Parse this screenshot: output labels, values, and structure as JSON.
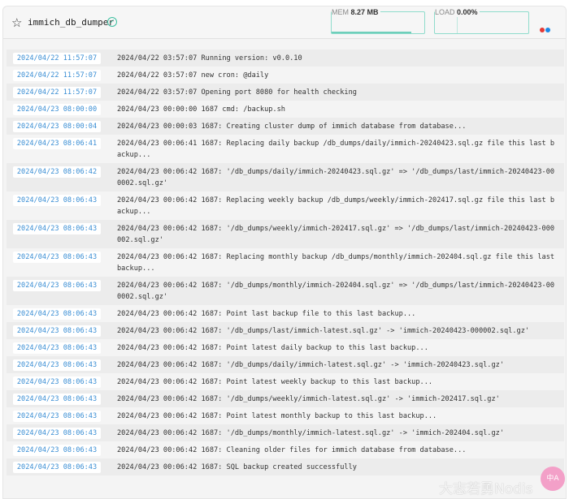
{
  "header": {
    "title": "immich_db_dumper",
    "mem_label": "MEM",
    "mem_value": "8.27 MB",
    "mem_fraction": 0.86,
    "load_label": "LOAD",
    "load_value": "0.00%",
    "status_colors": [
      "#e53935",
      "#1e88e5"
    ]
  },
  "logs": [
    {
      "ts": "2024/04/22 11:57:07",
      "msg": "2024/04/22 03:57:07 Running version: v0.0.10"
    },
    {
      "ts": "2024/04/22 11:57:07",
      "msg": "2024/04/22 03:57:07 new cron: @daily"
    },
    {
      "ts": "2024/04/22 11:57:07",
      "msg": "2024/04/22 03:57:07 Opening port 8080 for health checking"
    },
    {
      "ts": "2024/04/23 08:00:00",
      "msg": "2024/04/23 00:00:00 1687 cmd: /backup.sh"
    },
    {
      "ts": "2024/04/23 08:00:04",
      "msg": "2024/04/23 00:00:03 1687: Creating cluster dump of immich database from database..."
    },
    {
      "ts": "2024/04/23 08:06:41",
      "msg": "2024/04/23 00:06:41 1687: Replacing daily backup /db_dumps/daily/immich-20240423.sql.gz file this last backup..."
    },
    {
      "ts": "2024/04/23 08:06:42",
      "msg": "2024/04/23 00:06:42 1687: '/db_dumps/daily/immich-20240423.sql.gz' => '/db_dumps/last/immich-20240423-000002.sql.gz'"
    },
    {
      "ts": "2024/04/23 08:06:43",
      "msg": "2024/04/23 00:06:42 1687: Replacing weekly backup /db_dumps/weekly/immich-202417.sql.gz file this last backup..."
    },
    {
      "ts": "2024/04/23 08:06:43",
      "msg": "2024/04/23 00:06:42 1687: '/db_dumps/weekly/immich-202417.sql.gz' => '/db_dumps/last/immich-20240423-000002.sql.gz'"
    },
    {
      "ts": "2024/04/23 08:06:43",
      "msg": "2024/04/23 00:06:42 1687: Replacing monthly backup /db_dumps/monthly/immich-202404.sql.gz file this last backup..."
    },
    {
      "ts": "2024/04/23 08:06:43",
      "msg": "2024/04/23 00:06:42 1687: '/db_dumps/monthly/immich-202404.sql.gz' => '/db_dumps/last/immich-20240423-000002.sql.gz'"
    },
    {
      "ts": "2024/04/23 08:06:43",
      "msg": "2024/04/23 00:06:42 1687: Point last backup file to this last backup..."
    },
    {
      "ts": "2024/04/23 08:06:43",
      "msg": "2024/04/23 00:06:42 1687: '/db_dumps/last/immich-latest.sql.gz' -> 'immich-20240423-000002.sql.gz'"
    },
    {
      "ts": "2024/04/23 08:06:43",
      "msg": "2024/04/23 00:06:42 1687: Point latest daily backup to this last backup..."
    },
    {
      "ts": "2024/04/23 08:06:43",
      "msg": "2024/04/23 00:06:42 1687: '/db_dumps/daily/immich-latest.sql.gz' -> 'immich-20240423.sql.gz'"
    },
    {
      "ts": "2024/04/23 08:06:43",
      "msg": "2024/04/23 00:06:42 1687: Point latest weekly backup to this last backup..."
    },
    {
      "ts": "2024/04/23 08:06:43",
      "msg": "2024/04/23 00:06:42 1687: '/db_dumps/weekly/immich-latest.sql.gz' -> 'immich-202417.sql.gz'"
    },
    {
      "ts": "2024/04/23 08:06:43",
      "msg": "2024/04/23 00:06:42 1687: Point latest monthly backup to this last backup..."
    },
    {
      "ts": "2024/04/23 08:06:43",
      "msg": "2024/04/23 00:06:42 1687: '/db_dumps/monthly/immich-latest.sql.gz' -> 'immich-202404.sql.gz'"
    },
    {
      "ts": "2024/04/23 08:06:43",
      "msg": "2024/04/23 00:06:42 1687: Cleaning older files for immich database from database..."
    },
    {
      "ts": "2024/04/23 08:06:43",
      "msg": "2024/04/23 00:06:42 1687: SQL backup created successfully"
    }
  ],
  "overlay": {
    "translate_label": "中A",
    "watermark": "大志若勇Nodis"
  }
}
